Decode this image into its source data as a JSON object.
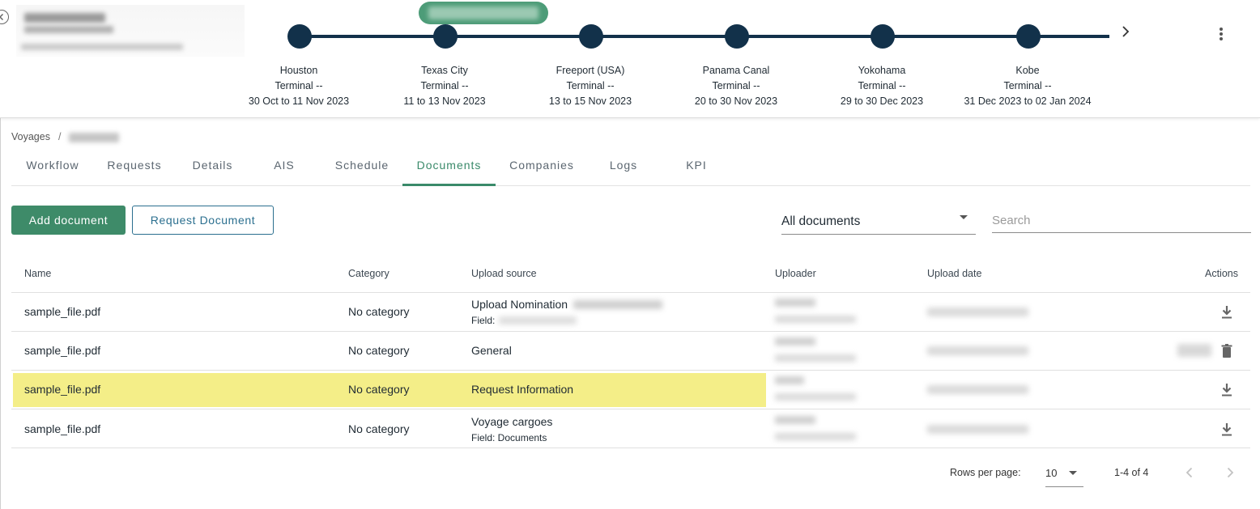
{
  "timeline": {
    "stops": [
      {
        "port": "Houston",
        "terminal": "Terminal --",
        "dates": "30 Oct to 11 Nov 2023"
      },
      {
        "port": "Texas City",
        "terminal": "Terminal --",
        "dates": "11 to 13 Nov 2023"
      },
      {
        "port": "Freeport (USA)",
        "terminal": "Terminal --",
        "dates": "13 to 15 Nov 2023"
      },
      {
        "port": "Panama Canal",
        "terminal": "Terminal --",
        "dates": "20 to 30 Nov 2023"
      },
      {
        "port": "Yokohama",
        "terminal": "Terminal --",
        "dates": "29 to 30 Dec 2023"
      },
      {
        "port": "Kobe",
        "terminal": "Terminal --",
        "dates": "31 Dec 2023 to 02 Jan 2024"
      }
    ]
  },
  "breadcrumb": {
    "root": "Voyages",
    "separator": "/"
  },
  "tabs": [
    "Workflow",
    "Requests",
    "Details",
    "AIS",
    "Schedule",
    "Documents",
    "Companies",
    "Logs",
    "KPI"
  ],
  "active_tab": "Documents",
  "toolbar": {
    "add_label": "Add document",
    "request_label": "Request Document",
    "filter_value": "All documents",
    "search_placeholder": "Search"
  },
  "table": {
    "headers": {
      "name": "Name",
      "category": "Category",
      "source": "Upload source",
      "uploader": "Uploader",
      "date": "Upload date",
      "actions": "Actions"
    },
    "rows": [
      {
        "name": "sample_file.pdf",
        "category": "No category",
        "source": "Upload Nomination",
        "field": "Field:",
        "highlighted": false,
        "action": "download"
      },
      {
        "name": "sample_file.pdf",
        "category": "No category",
        "source": "General",
        "field": "",
        "highlighted": false,
        "action": "delete"
      },
      {
        "name": "sample_file.pdf",
        "category": "No category",
        "source": "Request Information",
        "field": "",
        "highlighted": true,
        "action": "download"
      },
      {
        "name": "sample_file.pdf",
        "category": "No category",
        "source": "Voyage cargoes",
        "field": "Field: Documents",
        "highlighted": false,
        "action": "download"
      }
    ]
  },
  "pagination": {
    "rows_label": "Rows per page:",
    "rows_value": "10",
    "range": "1-4 of 4"
  },
  "colors": {
    "accent": "#3e8b69",
    "timeline": "#12314a",
    "highlight": "#f4ee88",
    "outline_button": "#2b6f8f"
  }
}
